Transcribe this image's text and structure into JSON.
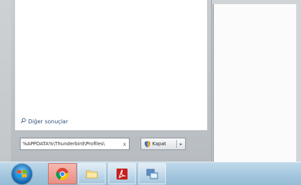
{
  "start_menu": {
    "more_results": "Diğer sonuçlar",
    "search_value": "%APPDATA%\\Thunderbird\\Profiles\\",
    "clear_symbol": "x",
    "shutdown_label": "Kapat",
    "shutdown_arrow": "▸"
  },
  "taskbar": {
    "items": [
      {
        "icon": "start-orb-icon"
      },
      {
        "icon": "chrome-icon",
        "active": true
      },
      {
        "icon": "folder-icon"
      },
      {
        "icon": "acrobat-icon"
      },
      {
        "icon": "window-switch-icon"
      }
    ]
  },
  "colors": {
    "taskbar": "#a4c6de",
    "active_button": "#e88f86",
    "link": "#2b4f7d"
  }
}
